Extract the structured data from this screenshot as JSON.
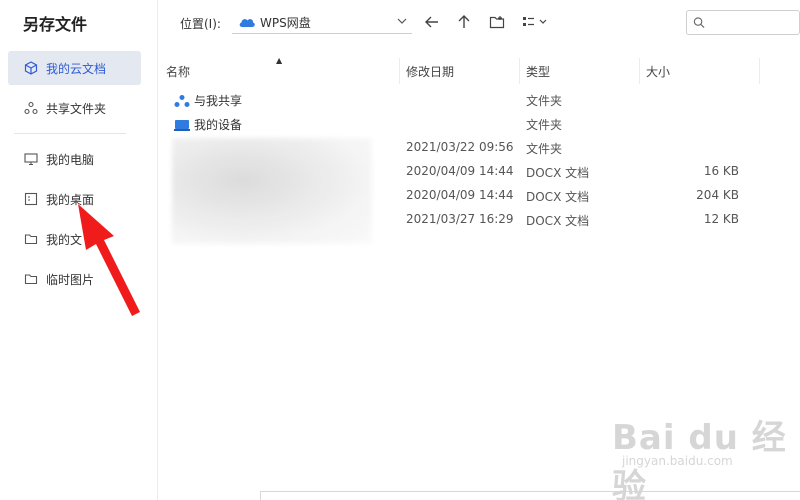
{
  "dialog": {
    "title": "另存文件"
  },
  "sidebar": {
    "items": [
      {
        "label": "我的云文档",
        "icon": "cube-icon"
      },
      {
        "label": "共享文件夹",
        "icon": "share-icon"
      },
      {
        "label": "我的电脑",
        "icon": "monitor-icon"
      },
      {
        "label": "我的桌面",
        "icon": "desktop-icon"
      },
      {
        "label": "我的文",
        "icon": "folder-icon"
      },
      {
        "label": "临时图片",
        "icon": "folder-icon"
      }
    ]
  },
  "toolbar": {
    "location_label": "位置(I):",
    "location_value": "WPS网盘"
  },
  "search": {
    "placeholder": ""
  },
  "columns": {
    "name": "名称",
    "modified": "修改日期",
    "type": "类型",
    "size": "大小"
  },
  "rows": [
    {
      "name": "与我共享",
      "modified": "",
      "type": "文件夹",
      "size": "",
      "icon": "share-folder-icon"
    },
    {
      "name": "我的设备",
      "modified": "",
      "type": "文件夹",
      "size": "",
      "icon": "device-folder-icon"
    },
    {
      "name": "",
      "modified": "2021/03/22 09:56",
      "type": "文件夹",
      "size": ""
    },
    {
      "name": "",
      "modified": "2020/04/09 14:44",
      "type": "DOCX 文档",
      "size": "16 KB"
    },
    {
      "name": "",
      "modified": "2020/04/09 14:44",
      "type": "DOCX 文档",
      "size": "204 KB"
    },
    {
      "name": "",
      "modified": "2021/03/27 16:29",
      "type": "DOCX 文档",
      "size": "12 KB"
    }
  ],
  "watermark": {
    "brand": "Bai du 经验",
    "site": "jingyan.baidu.com"
  },
  "colors": {
    "accent": "#2f5bd4",
    "active_bg": "#e4e8f0",
    "arrow": "#f01c1c"
  }
}
